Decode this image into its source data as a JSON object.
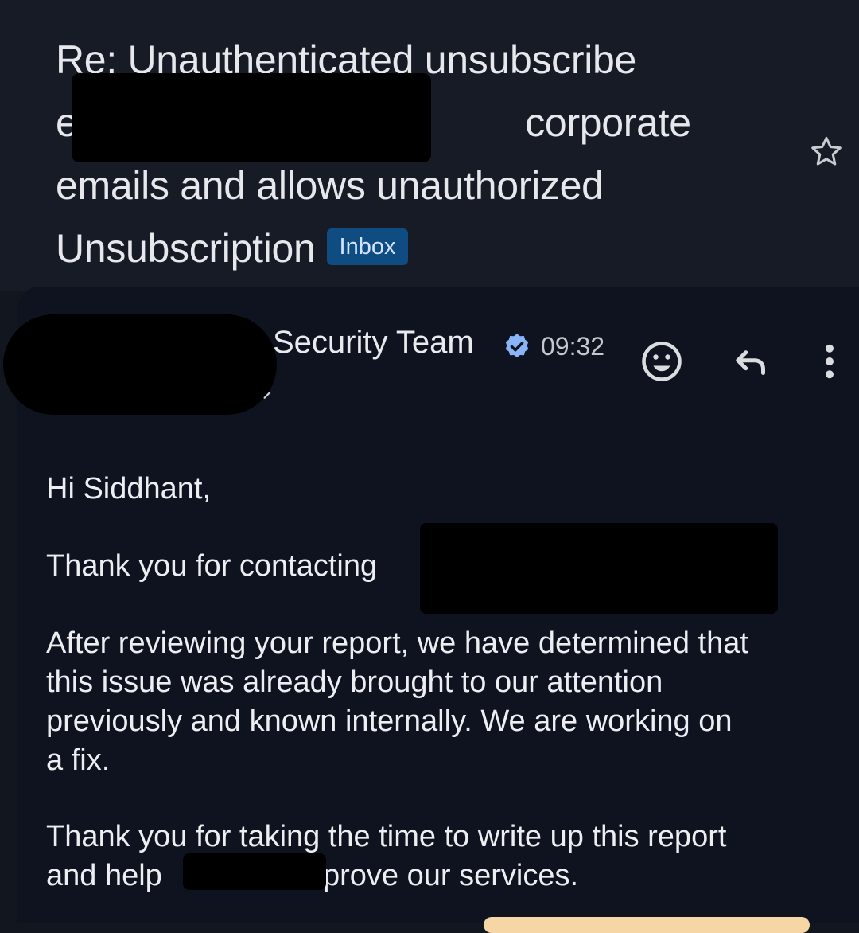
{
  "subject": {
    "line1": "Re: Unauthenticated unsubscribe",
    "line2_start": "e",
    "line2_end": "corporate",
    "line3": "emails and allows unauthorized",
    "line4": "Unsubscription",
    "label": "Inbox"
  },
  "message": {
    "sender": "Security Team",
    "time": "09:32",
    "greeting": "Hi Siddhant,",
    "para1": "Thank you for contacting",
    "para2_lines": [
      "After reviewing your report, we have determined that",
      "this issue was already brought to our attention",
      "previously and known internally. We are working on",
      "a fix."
    ],
    "para3_line1": "Thank you for taking the time to write up this report",
    "para3_line2_start": "and help",
    "para3_line2_end": "prove our services."
  },
  "icons": {
    "star": "star-icon",
    "verified": "verified-badge-icon",
    "emoji": "add-reaction-icon",
    "reply": "reply-icon",
    "more": "more-vertical-icon",
    "expand": "chevron-down-icon"
  },
  "colors": {
    "background": "#12161f",
    "card": "#0f1320",
    "label_chip": "#0f4c81",
    "verified": "#8ab4f8",
    "redaction": "#000000"
  }
}
